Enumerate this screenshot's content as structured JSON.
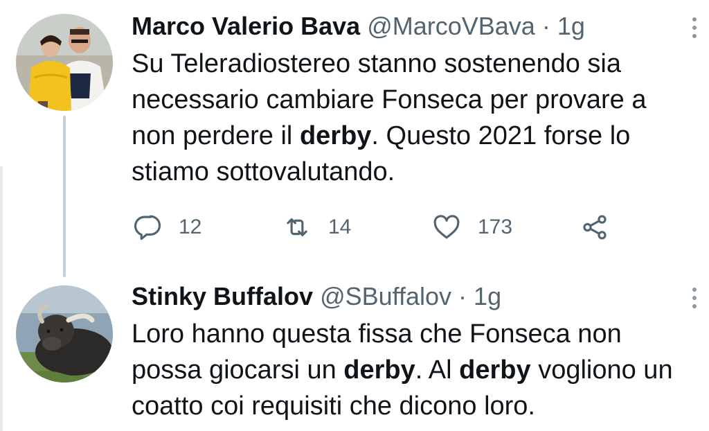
{
  "tweets": [
    {
      "name": "Marco Valerio Bava",
      "handle": "@MarcoVBava",
      "time": "1g",
      "separator": " · ",
      "text": {
        "line1": "Su Teleradiostereo stanno sostenendo sia",
        "line2": "necessario cambiare Fonseca per provare a",
        "line3_pre": "non perdere il ",
        "line3_bold": "derby",
        "line3_post": ". Questo 2021 forse lo",
        "line4": "stiamo sottovalutando."
      },
      "actions": {
        "replies": "12",
        "retweets": "14",
        "likes": "173"
      }
    },
    {
      "name": "Stinky Buffalov",
      "handle": "@SBuffalov",
      "time": "1g",
      "separator": " · ",
      "text": {
        "line1": "Loro hanno questa fissa che Fonseca non",
        "line2_pre": "possa giocarsi un ",
        "line2_bold1": "derby",
        "line2_mid": ". Al ",
        "line2_bold2": "derby",
        "line2_post": " vogliono un",
        "line3": "coatto coi requisiti che dicono loro."
      }
    }
  ],
  "icons": {
    "reply": "reply-icon",
    "retweet": "retweet-icon",
    "like": "heart-icon",
    "share": "share-icon",
    "more": "more-vertical-icon"
  },
  "colors": {
    "text": "#0f1419",
    "secondary": "#536471",
    "thread_line": "#c4cfd6"
  }
}
